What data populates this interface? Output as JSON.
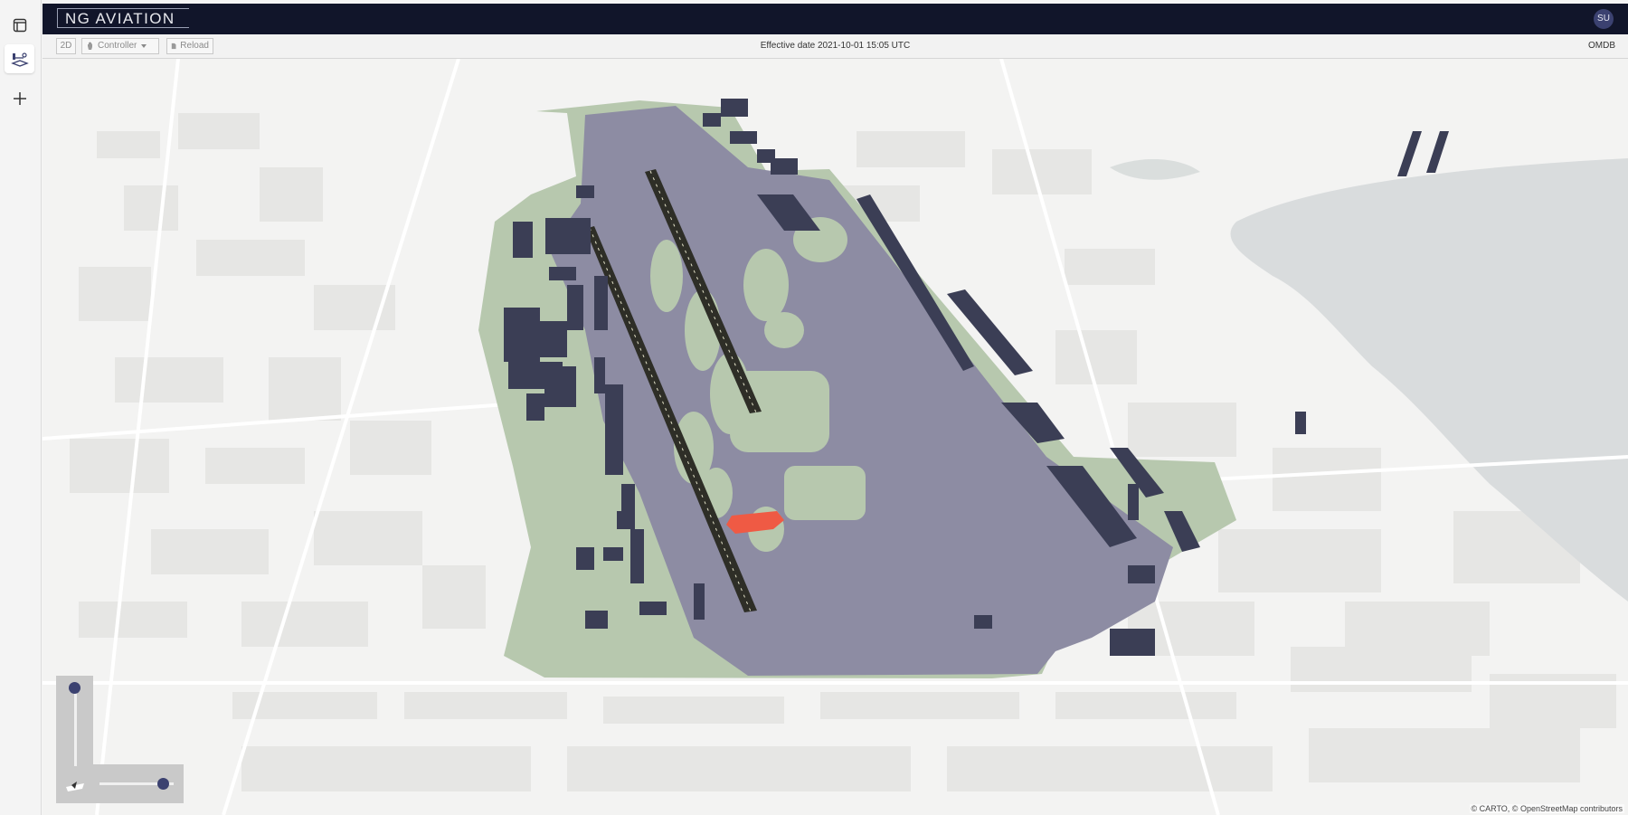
{
  "app": {
    "logo": "NG AVIATION",
    "user_initials": "SU"
  },
  "rail": {
    "icons": [
      "layers-icon",
      "map-layers-icon",
      "plus-icon"
    ]
  },
  "toolbar": {
    "mode_2d": "2D",
    "controller_label": "Controller",
    "reload_label": "Reload",
    "effective_date": "Effective date 2021-10-01 15:05 UTC",
    "airport_code": "OMDB"
  },
  "map": {
    "attribution": "© CARTO, © OpenStreetMap contributors",
    "colors": {
      "base": "#f3f3f2",
      "water": "#d9dcdd",
      "airport_grass": "#b7c8ae",
      "apron": "#8d8ca3",
      "runway": "#2e2e27",
      "buildings": "#3b3e55",
      "highlight": "#ef5a44"
    }
  },
  "controls": {
    "zoom_level": 0.05,
    "pitch_level": 0.8
  }
}
